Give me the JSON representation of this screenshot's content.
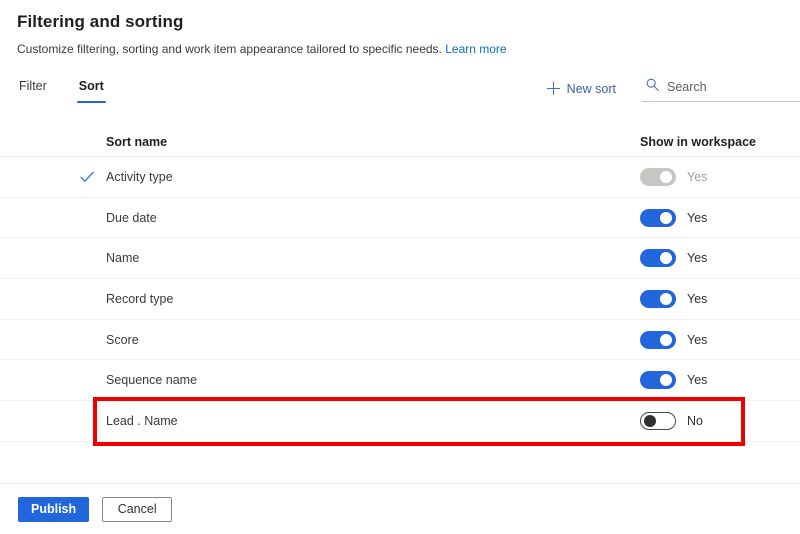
{
  "header": {
    "title": "Filtering and sorting",
    "subtitle": "Customize filtering, sorting and work item appearance tailored to specific needs.",
    "learn_more_label": "Learn more"
  },
  "command_bar": {
    "tabs": [
      {
        "label": "Filter",
        "active": false
      },
      {
        "label": "Sort",
        "active": true
      }
    ],
    "new_sort_label": "New sort",
    "search": {
      "placeholder": "Search",
      "value": ""
    }
  },
  "table": {
    "columns": {
      "name": "Sort name",
      "toggle": "Show in workspace"
    },
    "rows": [
      {
        "name": "Activity type",
        "checked": true,
        "toggle_state": "on-disabled",
        "toggle_label": "Yes",
        "highlighted": false
      },
      {
        "name": "Due date",
        "checked": false,
        "toggle_state": "on",
        "toggle_label": "Yes",
        "highlighted": false
      },
      {
        "name": "Name",
        "checked": false,
        "toggle_state": "on",
        "toggle_label": "Yes",
        "highlighted": false
      },
      {
        "name": "Record type",
        "checked": false,
        "toggle_state": "on",
        "toggle_label": "Yes",
        "highlighted": false
      },
      {
        "name": "Score",
        "checked": false,
        "toggle_state": "on",
        "toggle_label": "Yes",
        "highlighted": false
      },
      {
        "name": "Sequence name",
        "checked": false,
        "toggle_state": "on",
        "toggle_label": "Yes",
        "highlighted": false
      },
      {
        "name": "Lead . Name",
        "checked": false,
        "toggle_state": "off",
        "toggle_label": "No",
        "highlighted": true
      }
    ]
  },
  "footer": {
    "publish_label": "Publish",
    "cancel_label": "Cancel"
  },
  "colors": {
    "accent": "#2266dd",
    "link": "#0f6cbd",
    "highlight": "#ee0000",
    "toggle_on": "#2266dd",
    "toggle_disabled": "#c8c6c4",
    "toggle_off_border": "#484644"
  },
  "icons": {
    "check": "check-icon",
    "plus": "plus-icon",
    "search": "search-icon"
  }
}
